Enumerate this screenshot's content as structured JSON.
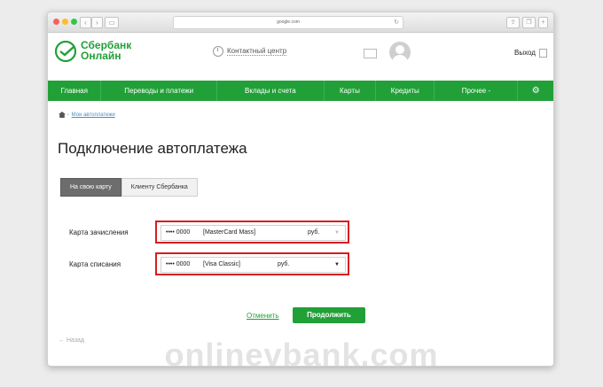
{
  "browser": {
    "address": "google.com"
  },
  "header": {
    "logo": {
      "line1": "Сбербанк",
      "line2": "Онлайн"
    },
    "contact_center": "Контактный центр",
    "logout": "Выход"
  },
  "menu": [
    "Главная",
    "Переводы и платежи",
    "Вклады и счета",
    "Карты",
    "Кредиты",
    "Прочее -"
  ],
  "breadcrumb": {
    "link": "Мои автоплатежи"
  },
  "page_title": "Подключение автоплатежа",
  "tabs": [
    "На свою карту",
    "Клиенту Сбербанка"
  ],
  "fields": {
    "credit_card": {
      "label": "Карта зачисления",
      "mask": "•••• 0000",
      "name": "[MasterCard Mass]",
      "currency": "руб."
    },
    "debit_card": {
      "label": "Карта списания",
      "mask": "•••• 0000",
      "name": "[Visa Classic]",
      "currency": "руб."
    }
  },
  "actions": {
    "cancel": "Отменить",
    "continue": "Продолжить",
    "back": "Назад"
  },
  "watermark": "onlinevbank.com",
  "colors": {
    "brand": "#21a038",
    "highlight": "#d61d22"
  }
}
